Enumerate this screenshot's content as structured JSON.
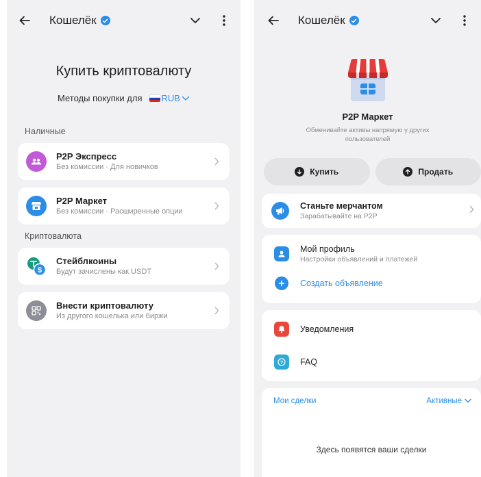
{
  "left": {
    "header": {
      "title": "Кошелёк"
    },
    "page_title": "Купить криптовалюту",
    "methods": {
      "label": "Методы покупки для",
      "currency": "RUB"
    },
    "sections": [
      {
        "label": "Наличные",
        "items": [
          {
            "title": "P2P Экспресс",
            "subtitle": "Без комиссии · Для новичков"
          },
          {
            "title": "P2P Маркет",
            "subtitle": "Без комиссии · Расширенные опции"
          }
        ]
      },
      {
        "label": "Криптовалюта",
        "items": [
          {
            "title": "Стейблкоины",
            "subtitle": "Будут зачислены как USDT"
          },
          {
            "title": "Внести криптовалюту",
            "subtitle": "Из другого кошелька или биржи"
          }
        ]
      }
    ]
  },
  "right": {
    "header": {
      "title": "Кошелёк"
    },
    "market": {
      "title": "P2P Маркет",
      "subtitle": "Обменивайте активы напрямую у других пользователей"
    },
    "buy_label": "Купить",
    "sell_label": "Продать",
    "merchant": {
      "title": "Станьте мерчантом",
      "subtitle": "Зарабатывайте на P2P"
    },
    "profile": {
      "title": "Мой профиль",
      "subtitle": "Настройки объявлений и платежей"
    },
    "create_ad": "Создать объявление",
    "notifications": "Уведомления",
    "faq": "FAQ",
    "deals": {
      "title": "Мои сделки",
      "filter": "Активные",
      "empty": "Здесь появятся ваши сделки"
    }
  },
  "colors": {
    "accent": "#2b8de6",
    "background": "#f1f1f3",
    "card": "#ffffff",
    "express_icon": "#c25ad8",
    "market_icon": "#2b8de6",
    "stable_icon": "#1a9c7a",
    "deposit_icon": "#8d8f96",
    "merchant_icon": "#2b8de6",
    "notifications_icon": "#e8483c"
  },
  "icons": {
    "back": "arrow-left-icon",
    "verified": "verified-badge-icon",
    "expand": "chevron-down-icon",
    "more": "more-vertical-icon",
    "express": "users-icon",
    "market": "store-icon",
    "stable": "coins-icon",
    "deposit": "qr-icon",
    "row_arrow": "chevron-right-icon",
    "buy": "arrow-down-circle-icon",
    "sell": "arrow-up-circle-icon",
    "merchant": "megaphone-icon",
    "profile": "user-icon",
    "create": "plus-circle-icon",
    "notifications": "bell-icon",
    "faq": "question-icon"
  }
}
